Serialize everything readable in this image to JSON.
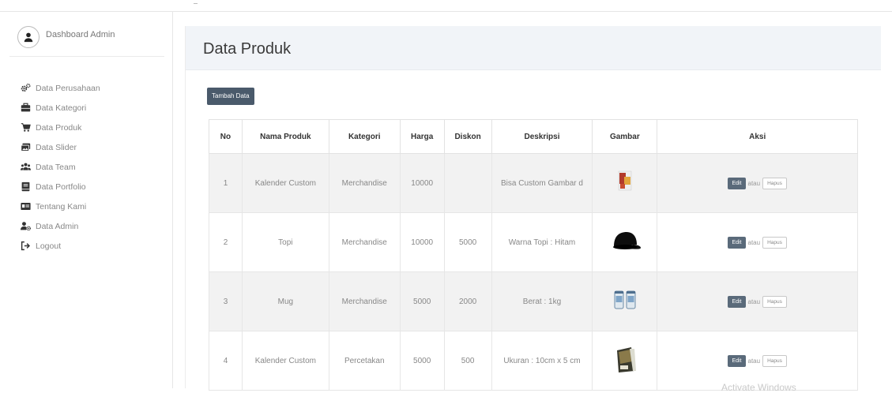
{
  "sidebar": {
    "title": "Dashboard Admin",
    "items": [
      {
        "label": "Data Perusahaan",
        "icon": "cogs-icon"
      },
      {
        "label": "Data Kategori",
        "icon": "briefcase-icon"
      },
      {
        "label": "Data Produk",
        "icon": "shopping-cart-icon"
      },
      {
        "label": "Data Slider",
        "icon": "images-icon"
      },
      {
        "label": "Data Team",
        "icon": "users-icon"
      },
      {
        "label": "Data Portfolio",
        "icon": "book-icon"
      },
      {
        "label": "Tentang Kami",
        "icon": "id-card-icon"
      },
      {
        "label": "Data Admin",
        "icon": "user-cog-icon"
      },
      {
        "label": "Logout",
        "icon": "sign-out-icon"
      }
    ]
  },
  "main": {
    "title": "Data Produk",
    "add_button": "Tambah Data",
    "table": {
      "headers": [
        "No",
        "Nama Produk",
        "Kategori",
        "Harga",
        "Diskon",
        "Deskripsi",
        "Gambar",
        "Aksi"
      ],
      "rows": [
        {
          "no": "1",
          "nama": "Kalender Custom",
          "kategori": "Merchandise",
          "harga": "10000",
          "diskon": "",
          "deskripsi": "Bisa Custom Gambar d",
          "gambar": "calendar-image"
        },
        {
          "no": "2",
          "nama": "Topi",
          "kategori": "Merchandise",
          "harga": "10000",
          "diskon": "5000",
          "deskripsi": "Warna Topi : Hitam",
          "gambar": "cap-image"
        },
        {
          "no": "3",
          "nama": "Mug",
          "kategori": "Merchandise",
          "harga": "5000",
          "diskon": "2000",
          "deskripsi": "Berat : 1kg",
          "gambar": "mug-image"
        },
        {
          "no": "4",
          "nama": "Kalender Custom",
          "kategori": "Percetakan",
          "harga": "5000",
          "diskon": "500",
          "deskripsi": "Ukuran : 10cm x 5 cm",
          "gambar": "desk-calendar-image"
        }
      ],
      "edit_label": "Edit",
      "atau_label": "atau",
      "hapus_label": "Hapus"
    }
  },
  "watermark": "Activate Windows",
  "colors": {
    "button_dark": "#4a5a6b",
    "title_bar_bg": "#f1f4f8",
    "row_alt_bg": "#f2f2f2"
  }
}
